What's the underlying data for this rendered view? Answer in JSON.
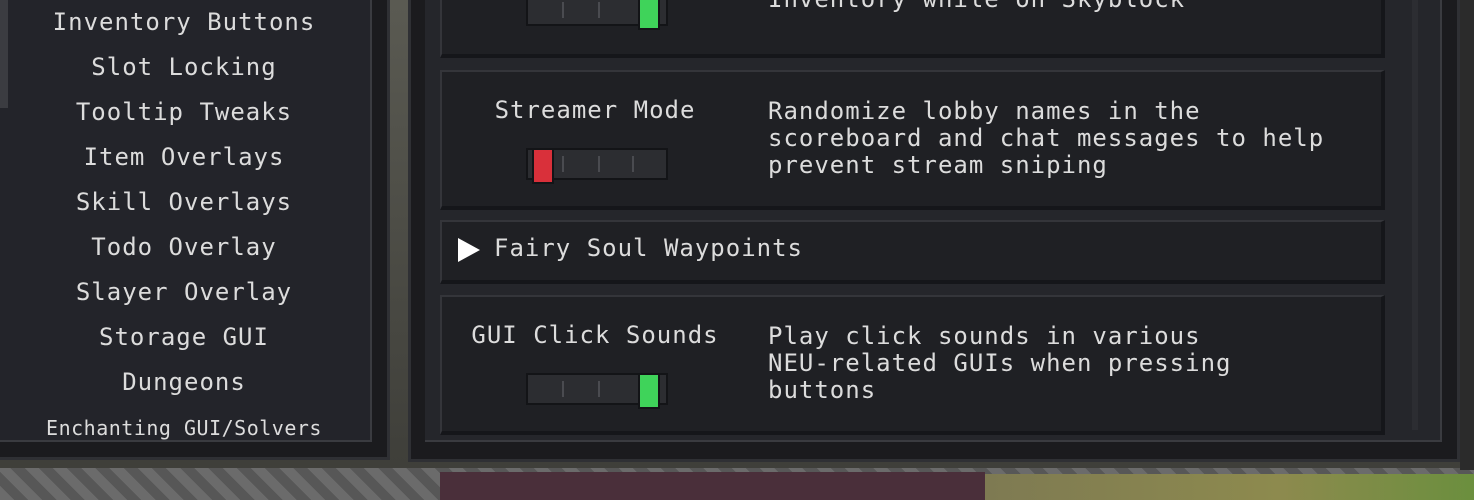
{
  "sidebar": {
    "items": [
      {
        "label": "Inventory Buttons"
      },
      {
        "label": "Slot Locking"
      },
      {
        "label": "Tooltip Tweaks"
      },
      {
        "label": "Item Overlays"
      },
      {
        "label": "Skill Overlays"
      },
      {
        "label": "Todo Overlay"
      },
      {
        "label": "Slayer Overlay"
      },
      {
        "label": "Storage GUI"
      },
      {
        "label": "Dungeons"
      },
      {
        "label": "Enchanting GUI/Solvers"
      }
    ]
  },
  "options": [
    {
      "title": "",
      "description": "Inventory while on Skyblock",
      "enabled": true
    },
    {
      "title": "Streamer Mode",
      "description": "Randomize lobby names in the\nscoreboard and chat messages to help\nprevent stream sniping",
      "enabled": false
    },
    {
      "accordion": "Fairy Soul Waypoints"
    },
    {
      "title": "GUI Click Sounds",
      "description": "Play click sounds in various\nNEU-related GUIs when pressing\nbuttons",
      "enabled": true
    }
  ],
  "colors": {
    "toggle_on": "#3fd35a",
    "toggle_off": "#d9303a",
    "panel": "#1f2024",
    "text": "#dcdcdc"
  },
  "icons": {
    "accordion": "play-triangle-icon"
  }
}
